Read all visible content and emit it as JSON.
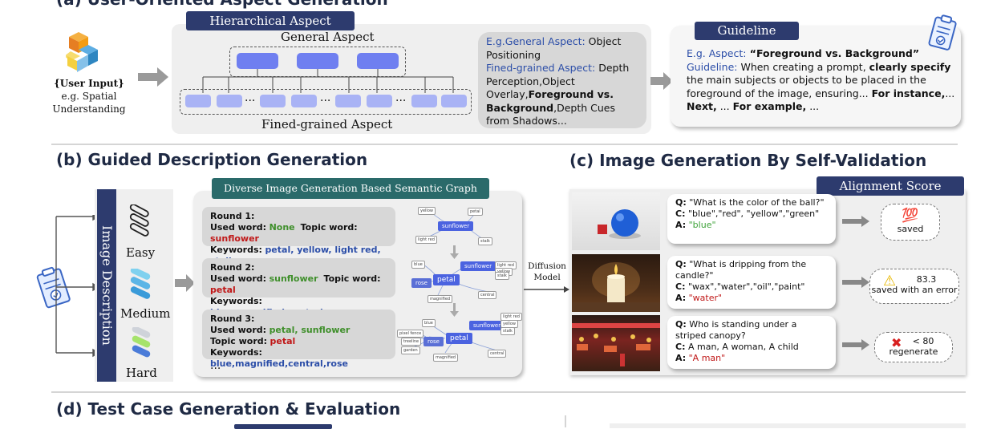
{
  "section_a": {
    "title": "(a) User-Oriented Aspect Generation",
    "tag": "Hierarchical Aspect",
    "user_input": {
      "label": "{User Input}",
      "example_line1": "e.g. Spatial",
      "example_line2": "Understanding"
    },
    "general_aspect": "General Aspect",
    "fine_grained_aspect": "Fined-grained Aspect",
    "example": {
      "general_prefix": "E.g.General Aspect:",
      "general_value": " Object Positioning",
      "fine_prefix": "Fined-grained Aspect:",
      "fine_value_1": " Depth Perception,Object Overlay,",
      "fine_bold": "Foreground vs. Background",
      "fine_value_2": ",Depth Cues from Shadows..."
    },
    "guideline": {
      "tag": "Guideline",
      "aspect_prefix": "E.g. Aspect:",
      "aspect_value": " “Foreground vs. Background”",
      "guideline_prefix": "Guideline:",
      "text_1": " When creating a prompt, ",
      "bold_1": "clearly specify",
      "text_2": " the main subjects or objects to be placed in the foreground of the image, ensuring... ",
      "bold_2": "For instance,",
      "text_3": "...",
      "bold_3": "Next,",
      "text_4": " ... ",
      "bold_4": "For example,",
      "text_5": " ..."
    }
  },
  "section_b": {
    "title": "(b) Guided Description Generation",
    "vertical_label": "Image Description",
    "levels": [
      "Easy",
      "Medium",
      "Hard"
    ],
    "graph_tag": "Diverse Image Generation Based Semantic Graph",
    "rounds": [
      {
        "round": "Round 1:",
        "used_label": "Used word:",
        "used": "None",
        "topic_label": "Topic word:",
        "topic": "sunflower",
        "kw_label": "Keywords:",
        "keywords": "petal, yellow, light red, stalk"
      },
      {
        "round": "Round 2:",
        "used_label": "Used word:",
        "used": "sunflower",
        "topic_label": "Topic word:",
        "topic": "petal",
        "kw_label": "Keywords:",
        "keywords": "blue,magnified,central,rose"
      },
      {
        "round": "Round 3:",
        "used_label": "Used word:",
        "used": "petal, sunflower",
        "topic_label": "Topic word:",
        "topic": "petal",
        "kw_label": "Keywords:",
        "keywords": "blue,magnified,central,rose"
      }
    ],
    "ellipsis": "...",
    "graph1": {
      "core": "sunflower",
      "nodes": [
        "yellow",
        "petal",
        "light red",
        "stalk"
      ]
    },
    "graph2": {
      "cores": [
        "sunflower",
        "petal"
      ],
      "nodes": [
        "blue",
        "rose",
        "magnified",
        "central",
        "light red",
        "yellow",
        "stalk"
      ]
    },
    "graph3": {
      "cores": [
        "sunflower",
        "petal",
        "rose"
      ],
      "nodes": [
        "blue",
        "pixel fence",
        "treeline",
        "garden",
        "magnified",
        "central",
        "light red",
        "yellow",
        "stalk"
      ]
    },
    "diffusion_line1": "Diffusion",
    "diffusion_line2": "Model"
  },
  "section_c": {
    "title": "(c) Image Generation  By Self-Validation",
    "tag": "Alignment Score",
    "rows": [
      {
        "q": "\"What is the color of the ball?\"",
        "c": "\"blue\",\"red\", \"yellow\",\"green\"",
        "a": "\"blue\"",
        "score_icon": "💯",
        "score_text": "saved"
      },
      {
        "q": "\"What is dripping from the candle?\"",
        "c": "\"wax\",\"water\",\"oil\",\"paint\"",
        "a": "\"water\"",
        "score_icon": "⚠",
        "score_value": "83.3",
        "score_text": "saved with an error"
      },
      {
        "q": "Who is standing under a striped canopy?",
        "c": "A man, A woman, A child",
        "a": "\"A man\"",
        "score_icon": "✖",
        "score_value": "< 80",
        "score_text": "regenerate"
      }
    ],
    "labels": {
      "q": "Q:",
      "c": "C:",
      "a": "A:"
    }
  },
  "section_d": {
    "title": "(d) Test Case Generation & Evaluation"
  },
  "colors": {
    "navy": "#2d3b6e",
    "node_blue": "#6f7ff0",
    "node_lilac": "#a9b3f5",
    "keyword_blue": "#2c4ea8",
    "used_green": "#3f8f2b",
    "topic_red": "#c01818"
  }
}
